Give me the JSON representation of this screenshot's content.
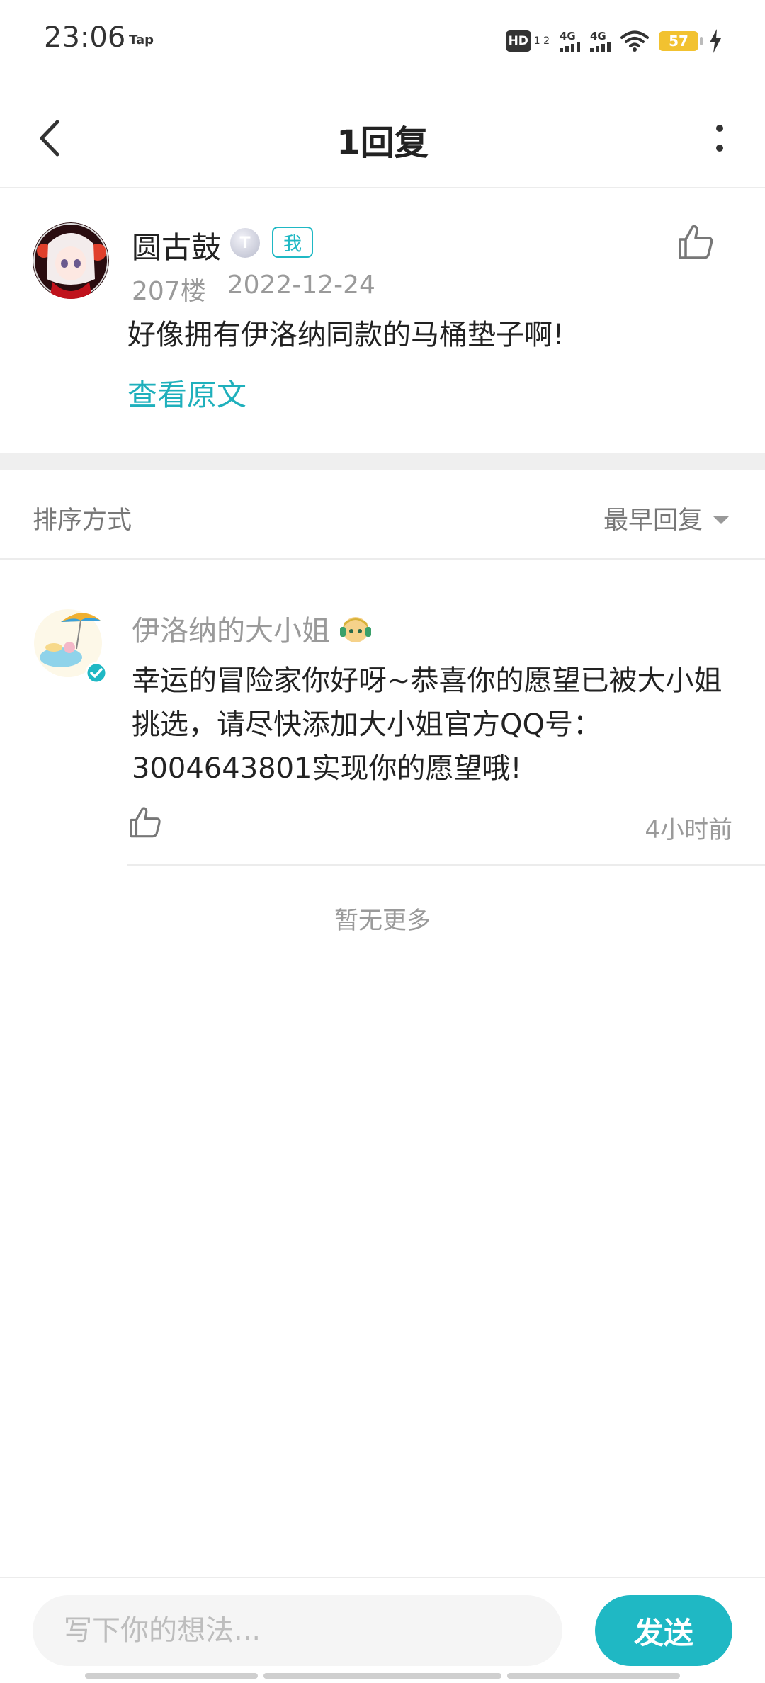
{
  "status_bar": {
    "time": "23:06",
    "tap_label": "Tap",
    "hd_label": "HD",
    "hd_sub": "1 2",
    "network1": "4G",
    "network2": "4G",
    "battery": "57"
  },
  "header": {
    "title": "1回复"
  },
  "original_post": {
    "author": "圆古鼓",
    "level_badge": "T",
    "me_tag": "我",
    "floor": "207楼",
    "date": "2022-12-24",
    "content": "好像拥有伊洛纳同款的马桶垫子啊!",
    "view_original_label": "查看原文"
  },
  "sort": {
    "label": "排序方式",
    "selected": "最早回复"
  },
  "reply": {
    "author": "伊洛纳的大小姐",
    "content": "幸运的冒险家你好呀~恭喜你的愿望已被大小姐挑选，请尽快添加大小姐官方QQ号：3004643801实现你的愿望哦!",
    "time": "4小时前"
  },
  "no_more": "暂无更多",
  "composer": {
    "placeholder": "写下你的想法...",
    "send_label": "发送"
  },
  "colors": {
    "accent": "#1fb8c4",
    "muted_text": "#9a9a9a"
  }
}
